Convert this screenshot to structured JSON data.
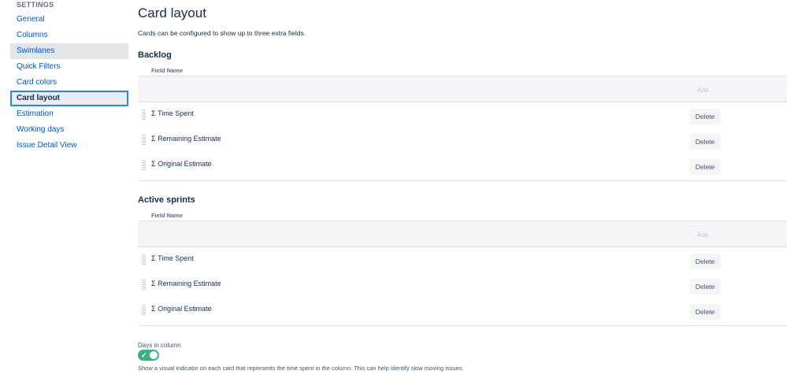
{
  "sidebar": {
    "heading": "SETTINGS",
    "items": [
      {
        "label": "General"
      },
      {
        "label": "Columns"
      },
      {
        "label": "Swimlanes"
      },
      {
        "label": "Quick Filters"
      },
      {
        "label": "Card colors"
      },
      {
        "label": "Card layout"
      },
      {
        "label": "Estimation"
      },
      {
        "label": "Working days"
      },
      {
        "label": "Issue Detail View"
      }
    ],
    "selected": "Card layout"
  },
  "main": {
    "title": "Card layout",
    "description": "Cards can be configured to show up to three extra fields.",
    "backlog": {
      "title": "Backlog",
      "column_header": "Field Name",
      "add_label": "Add",
      "fields": [
        {
          "name": "Σ Time Spent",
          "delete_label": "Delete"
        },
        {
          "name": "Σ Remaining Estimate",
          "delete_label": "Delete"
        },
        {
          "name": "Σ Original Estimate",
          "delete_label": "Delete"
        }
      ]
    },
    "active_sprints": {
      "title": "Active sprints",
      "column_header": "Field Name",
      "add_label": "Add",
      "fields": [
        {
          "name": "Σ Time Spent",
          "delete_label": "Delete"
        },
        {
          "name": "Σ Remaining Estimate",
          "delete_label": "Delete"
        },
        {
          "name": "Σ Original Estimate",
          "delete_label": "Delete"
        }
      ]
    },
    "days_in_column": {
      "label": "Days in column",
      "enabled": true,
      "check_glyph": "✓",
      "description": "Show a visual indicator on each card that represents the time spent in the column. This can help identify slow moving issues."
    }
  },
  "colors": {
    "link": "#0052cc",
    "selected_border": "#2684ff",
    "toggle_on": "#36b37e"
  }
}
